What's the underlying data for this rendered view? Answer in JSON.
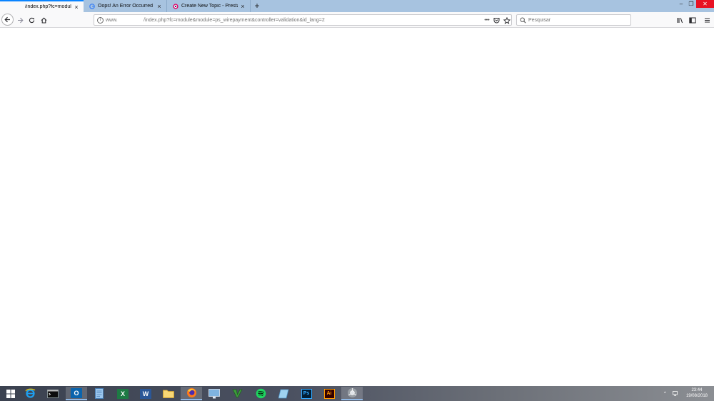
{
  "browser": {
    "tabs": [
      {
        "title": "/index.php?fc=module&",
        "active": true
      },
      {
        "title": "Oops! An Error Occurred presta",
        "active": false,
        "favicon": "google-icon"
      },
      {
        "title": "Create New Topic - PrestaShop",
        "active": false,
        "favicon": "prestashop-icon"
      }
    ],
    "new_tab": "+",
    "window_controls": {
      "minimize": "–",
      "restore": "❐",
      "close": "✕"
    }
  },
  "navbar": {
    "url_host": "www.",
    "url_path": "/index.php?fc=module&module=ps_wirepayment&controller=validation&id_lang=2",
    "page_actions": "•••",
    "search_placeholder": "Pesquisar"
  },
  "taskbar": {
    "apps": [
      "windows-start-icon",
      "internet-explorer-icon",
      "terminal-icon",
      "outlook-icon",
      "notepad-icon",
      "excel-icon",
      "word-icon",
      "file-explorer-icon",
      "firefox-icon",
      "remote-desktop-icon",
      "vim-icon",
      "spotify-icon",
      "pen-tablet-icon",
      "photoshop-icon",
      "illustrator-icon",
      "chrome-icon"
    ],
    "labels": {
      "outlook": "O",
      "excel": "X",
      "word": "W",
      "photoshop": "Ps",
      "illustrator": "Ai"
    },
    "clock_time": "23:44",
    "clock_date": "19/08/2018"
  },
  "colors": {
    "tabstrip": "#a7c3e0",
    "accent": "#0a84ff",
    "close_red": "#e81123"
  }
}
